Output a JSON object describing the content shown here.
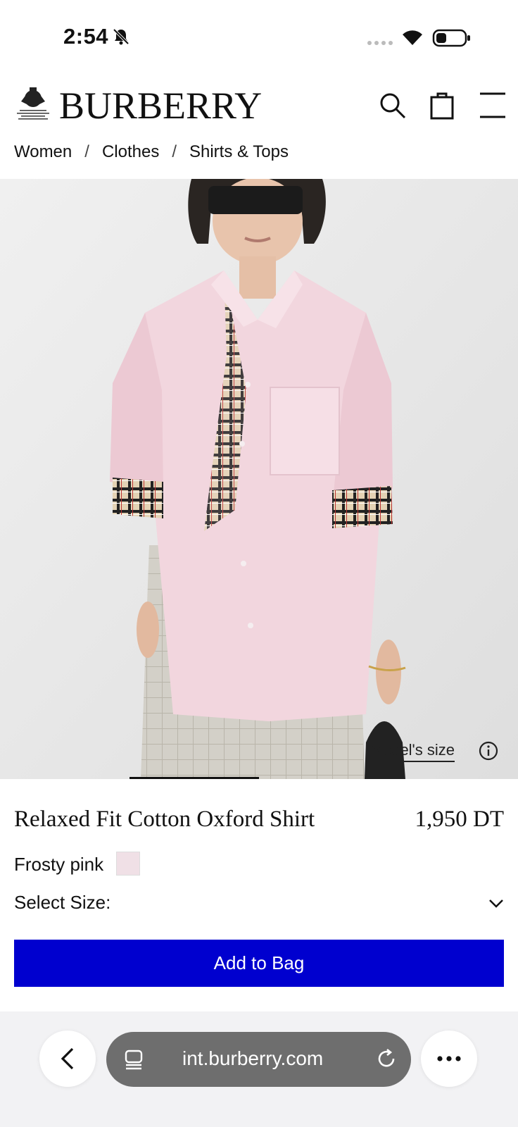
{
  "status_bar": {
    "time": "2:54"
  },
  "header": {
    "brand": "BURBERRY"
  },
  "breadcrumb": {
    "items": [
      "Women",
      "Clothes",
      "Shirts & Tops"
    ],
    "separator": "/"
  },
  "hero": {
    "model_size_label": "Model's size",
    "gallery_position": 0.25
  },
  "product": {
    "name": "Relaxed Fit Cotton Oxford Shirt",
    "price": "1,950 DT",
    "color_name": "Frosty pink",
    "swatch_color": "#f0e0e6",
    "size_label": "Select Size:",
    "add_to_bag": "Add to Bag"
  },
  "browser": {
    "url": "int.burberry.com"
  },
  "colors": {
    "accent": "#0000cf",
    "pill": "#6e6e6e"
  }
}
